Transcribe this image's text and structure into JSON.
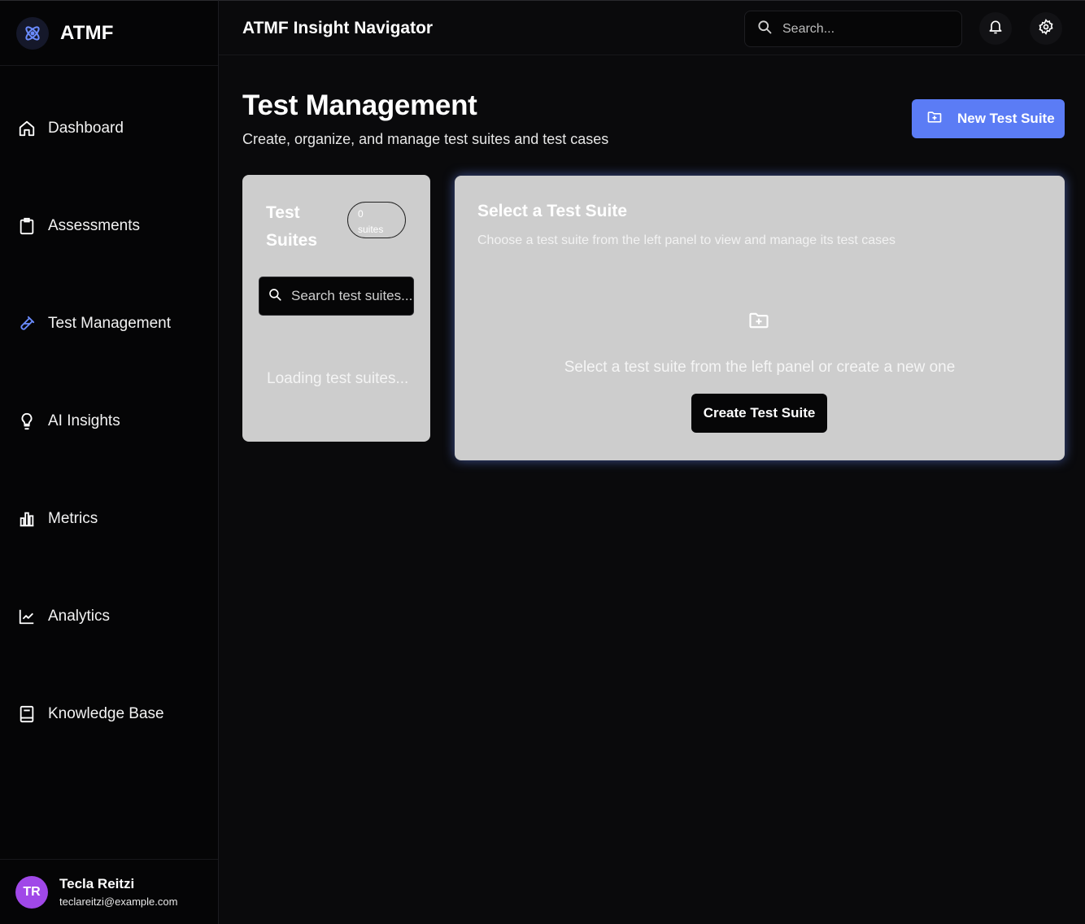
{
  "brand": {
    "name": "ATMF",
    "logo_icon": "atom-icon"
  },
  "sidebar": {
    "items": [
      {
        "label": "Dashboard",
        "icon": "home-icon"
      },
      {
        "label": "Assessments",
        "icon": "clipboard-icon"
      },
      {
        "label": "Test Management",
        "icon": "test-tube-icon",
        "active": true
      },
      {
        "label": "AI Insights",
        "icon": "lightbulb-icon"
      },
      {
        "label": "Metrics",
        "icon": "bar-chart-icon"
      },
      {
        "label": "Analytics",
        "icon": "line-chart-icon"
      },
      {
        "label": "Knowledge Base",
        "icon": "book-icon"
      }
    ]
  },
  "user": {
    "initials": "TR",
    "name": "Tecla Reitzi",
    "email": "teclareitzi@example.com"
  },
  "header": {
    "title": "ATMF Insight Navigator",
    "search_placeholder": "Search..."
  },
  "page": {
    "title": "Test Management",
    "subtitle": "Create, organize, and manage test suites and test cases",
    "new_button": "New Test Suite"
  },
  "suites_panel": {
    "title": "Test Suites",
    "count": "0",
    "count_unit": "suites",
    "search_placeholder": "Search test suites...",
    "loading_text": "Loading test suites..."
  },
  "detail_panel": {
    "title": "Select a Test Suite",
    "subtitle": "Choose a test suite from the left panel to view and manage its test cases",
    "empty_text": "Select a test suite from the left panel or create a new one",
    "create_button": "Create Test Suite"
  },
  "colors": {
    "accent": "#5b7cf5",
    "active_icon": "#6b8cff",
    "avatar": "#a048e8",
    "panel": "#cdcdcd",
    "background": "#0a0a0c"
  }
}
